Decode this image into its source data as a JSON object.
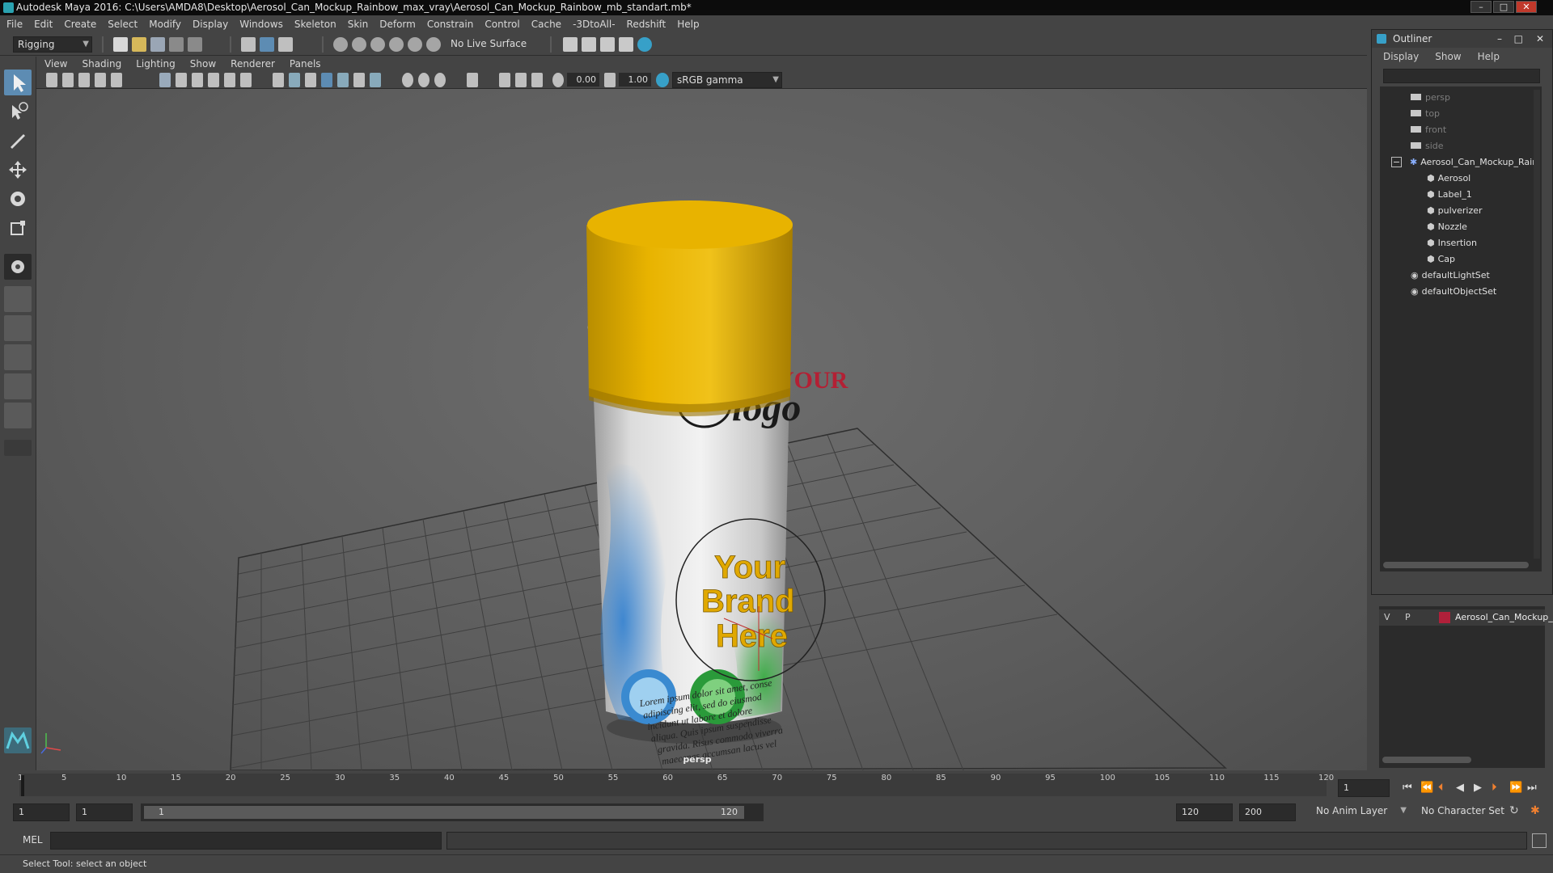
{
  "window": {
    "title": "Autodesk Maya 2016: C:\\Users\\AMDA8\\Desktop\\Aerosol_Can_Mockup_Rainbow_max_vray\\Aerosol_Can_Mockup_Rainbow_mb_standart.mb*",
    "minimize": "–",
    "maximize": "□",
    "close": "✕"
  },
  "menu": [
    "File",
    "Edit",
    "Create",
    "Select",
    "Modify",
    "Display",
    "Windows",
    "Skeleton",
    "Skin",
    "Deform",
    "Constrain",
    "Control",
    "Cache",
    "-3DtoAll-",
    "Redshift",
    "Help"
  ],
  "shelf": {
    "mode": "Rigging",
    "live_surface": "No Live Surface"
  },
  "panel_menu": [
    "View",
    "Shading",
    "Lighting",
    "Show",
    "Renderer",
    "Panels"
  ],
  "panel_toolbar": {
    "exposure": "0.00",
    "gamma": "1.00",
    "colorspace": "sRGB gamma"
  },
  "viewport": {
    "camera_label": "persp",
    "label_top": "YOUR",
    "label_logo": "logo",
    "brand_lines": [
      "Your",
      "Brand",
      "Here"
    ],
    "lorem": [
      "Lorem ipsum dolor sit amet, conse",
      "adipiscing elit, sed do eiusmod",
      "incidunt ut labore et dolore",
      "aliqua. Quis ipsum suspendisse",
      "gravida. Risus commodo viverra",
      "maecenas accumsan lacus vel"
    ]
  },
  "outliner": {
    "title": "Outliner",
    "menu": [
      "Display",
      "Show",
      "Help"
    ],
    "items": [
      {
        "label": "persp",
        "dim": true,
        "indent": 0,
        "icon": "camera-icon"
      },
      {
        "label": "top",
        "dim": true,
        "indent": 0,
        "icon": "camera-icon"
      },
      {
        "label": "front",
        "dim": true,
        "indent": 0,
        "icon": "camera-icon"
      },
      {
        "label": "side",
        "dim": true,
        "indent": 0,
        "icon": "camera-icon"
      },
      {
        "label": "Aerosol_Can_Mockup_Rair",
        "dim": false,
        "indent": 0,
        "icon": "group-icon",
        "expand": "−"
      },
      {
        "label": "Aerosol",
        "dim": false,
        "indent": 1,
        "icon": "mesh-icon"
      },
      {
        "label": "Label_1",
        "dim": false,
        "indent": 1,
        "icon": "mesh-icon"
      },
      {
        "label": "pulverizer",
        "dim": false,
        "indent": 1,
        "icon": "mesh-icon"
      },
      {
        "label": "Nozzle",
        "dim": false,
        "indent": 1,
        "icon": "mesh-icon"
      },
      {
        "label": "Insertion",
        "dim": false,
        "indent": 1,
        "icon": "mesh-icon"
      },
      {
        "label": "Cap",
        "dim": false,
        "indent": 1,
        "icon": "mesh-icon"
      },
      {
        "label": "defaultLightSet",
        "dim": false,
        "indent": 0,
        "icon": "set-icon"
      },
      {
        "label": "defaultObjectSet",
        "dim": false,
        "indent": 0,
        "icon": "set-icon"
      }
    ]
  },
  "layer": {
    "v": "V",
    "p": "P",
    "name": "Aerosol_Can_Mockup_",
    "color": "#b0203a"
  },
  "timeline": {
    "ticks": [
      "1",
      "5",
      "10",
      "15",
      "20",
      "25",
      "30",
      "35",
      "40",
      "45",
      "50",
      "55",
      "60",
      "65",
      "70",
      "75",
      "80",
      "85",
      "90",
      "95",
      "100",
      "105",
      "110",
      "115",
      "120"
    ],
    "current_frame": "1"
  },
  "range": {
    "start": "1",
    "start2": "1",
    "slider_start": "1",
    "slider_end": "120",
    "end": "120",
    "end2": "200",
    "anim_layer": "No Anim Layer",
    "char_set": "No Character Set"
  },
  "cmd": {
    "lang": "MEL"
  },
  "help": {
    "text": "Select Tool: select an object"
  }
}
